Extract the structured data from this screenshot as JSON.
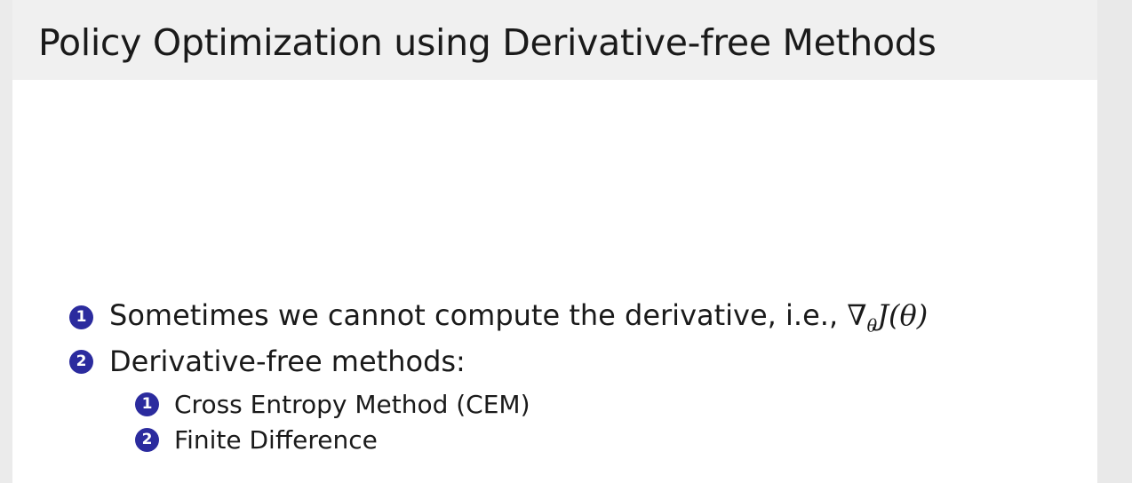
{
  "slide": {
    "title": "Policy Optimization using Derivative-free Methods",
    "items": [
      {
        "number": "1",
        "text": "Sometimes we cannot compute the derivative, i.e., ",
        "math": {
          "nabla": "∇",
          "sub": "θ",
          "expr": "J(θ)"
        }
      },
      {
        "number": "2",
        "text": "Derivative-free methods:",
        "subitems": [
          {
            "number": "1",
            "text": "Cross Entropy Method (CEM)"
          },
          {
            "number": "2",
            "text": "Finite Difference"
          }
        ]
      }
    ]
  }
}
